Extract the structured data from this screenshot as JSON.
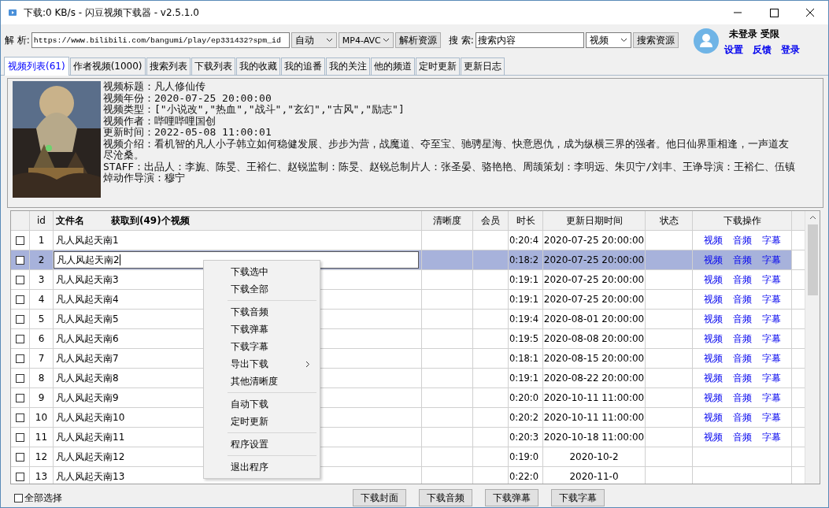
{
  "window": {
    "title": "下载:0 KB/s - 闪豆视频下载器 - v2.5.1.0"
  },
  "parse": {
    "label": "解 析:",
    "url": "https://www.bilibili.com/bangumi/play/ep331432?spm_id",
    "mode": "自动",
    "codec": "MP4-AVC",
    "button": "解析资源"
  },
  "search": {
    "label": "搜 索:",
    "value": "搜索内容",
    "type": "视频",
    "button": "搜索资源"
  },
  "account": {
    "status": "未登录 受限",
    "links": [
      "设置",
      "反馈",
      "登录"
    ]
  },
  "tabs": [
    {
      "label": "视频列表(61)",
      "selected": true
    },
    {
      "label": "作者视频(1000)",
      "selected": false
    },
    {
      "label": "搜索列表",
      "selected": false
    },
    {
      "label": "下载列表",
      "selected": false
    },
    {
      "label": "我的收藏",
      "selected": false
    },
    {
      "label": "我的追番",
      "selected": false
    },
    {
      "label": "我的关注",
      "selected": false
    },
    {
      "label": "他的频道",
      "selected": false
    },
    {
      "label": "定时更新",
      "selected": false
    },
    {
      "label": "更新日志",
      "selected": false
    }
  ],
  "info": {
    "lines": [
      "视频标题：凡人修仙传",
      "视频年份：2020-07-25 20:00:00",
      "视频类型：[\"小说改\",\"热血\",\"战斗\",\"玄幻\",\"古风\",\"励志\"]",
      "视频作者：哔哩哔哩国创",
      "更新时间：2022-05-08 11:00:01",
      "视频介绍：看机智的凡人小子韩立如何稳健发展、步步为营，战魔道、夺至宝、驰骋星海、快意恩仇，成为纵横三界的强者。他日仙界重相逢，一声道友尽沧桑。",
      "STAFF：出品人：李旎、陈旻、王裕仁、赵锐监制：陈旻、赵锐总制片人：张圣晏、骆艳艳、周颉策划：李明远、朱贝宁/刘丰、王诤导演：王裕仁、伍镇焯动作导演：穆宁"
    ]
  },
  "table": {
    "columns": [
      "id",
      "文件名",
      "获取到(49)个视频",
      "清晰度",
      "会员",
      "时长",
      "更新日期时间",
      "状态",
      "下载操作"
    ],
    "rows": [
      {
        "checked": false,
        "selected": false,
        "id": "1",
        "name": "凡人风起天南1",
        "duration": "0:20:4",
        "date": "2020-07-25 20:00:00",
        "actions": [
          "视频",
          "音频",
          "字幕"
        ]
      },
      {
        "checked": false,
        "selected": true,
        "id": "2",
        "name": "凡人风起天南2",
        "duration": "0:18:2",
        "date": "2020-07-25 20:00:00",
        "actions": [
          "视频",
          "音频",
          "字幕"
        ]
      },
      {
        "checked": false,
        "selected": false,
        "id": "3",
        "name": "凡人风起天南3",
        "duration": "0:19:1",
        "date": "2020-07-25 20:00:00",
        "actions": [
          "视频",
          "音频",
          "字幕"
        ]
      },
      {
        "checked": false,
        "selected": false,
        "id": "4",
        "name": "凡人风起天南4",
        "duration": "0:19:1",
        "date": "2020-07-25 20:00:00",
        "actions": [
          "视频",
          "音频",
          "字幕"
        ]
      },
      {
        "checked": false,
        "selected": false,
        "id": "5",
        "name": "凡人风起天南5",
        "duration": "0:19:4",
        "date": "2020-08-01 20:00:00",
        "actions": [
          "视频",
          "音频",
          "字幕"
        ]
      },
      {
        "checked": false,
        "selected": false,
        "id": "6",
        "name": "凡人风起天南6",
        "duration": "0:19:5",
        "date": "2020-08-08 20:00:00",
        "actions": [
          "视频",
          "音频",
          "字幕"
        ]
      },
      {
        "checked": false,
        "selected": false,
        "id": "7",
        "name": "凡人风起天南7",
        "duration": "0:18:1",
        "date": "2020-08-15 20:00:00",
        "actions": [
          "视频",
          "音频",
          "字幕"
        ]
      },
      {
        "checked": false,
        "selected": false,
        "id": "8",
        "name": "凡人风起天南8",
        "duration": "0:19:1",
        "date": "2020-08-22 20:00:00",
        "actions": [
          "视频",
          "音频",
          "字幕"
        ]
      },
      {
        "checked": false,
        "selected": false,
        "id": "9",
        "name": "凡人风起天南9",
        "duration": "0:20:0",
        "date": "2020-10-11 11:00:00",
        "actions": [
          "视频",
          "音频",
          "字幕"
        ]
      },
      {
        "checked": false,
        "selected": false,
        "id": "10",
        "name": "凡人风起天南10",
        "duration": "0:20:2",
        "date": "2020-10-11 11:00:00",
        "actions": [
          "视频",
          "音频",
          "字幕"
        ]
      },
      {
        "checked": false,
        "selected": false,
        "id": "11",
        "name": "凡人风起天南11",
        "duration": "0:20:3",
        "date": "2020-10-18 11:00:00",
        "actions": [
          "视频",
          "音频",
          "字幕"
        ]
      },
      {
        "checked": false,
        "selected": false,
        "id": "12",
        "name": "凡人风起天南12",
        "duration": "0:19:0",
        "date": "2020-10-2"
      },
      {
        "checked": false,
        "selected": false,
        "id": "13",
        "name": "凡人风起天南13",
        "duration": "0:22:0",
        "date": "2020-11-0"
      }
    ]
  },
  "context_menu": [
    {
      "kind": "item",
      "label": "下载选中",
      "submenu": false
    },
    {
      "kind": "item",
      "label": "下载全部",
      "submenu": false
    },
    {
      "kind": "separator"
    },
    {
      "kind": "item",
      "label": "下载音频",
      "submenu": false
    },
    {
      "kind": "item",
      "label": "下载弹幕",
      "submenu": false
    },
    {
      "kind": "item",
      "label": "下载字幕",
      "submenu": false
    },
    {
      "kind": "item",
      "label": "导出下载",
      "submenu": true
    },
    {
      "kind": "item",
      "label": "其他清晰度",
      "submenu": false
    },
    {
      "kind": "separator"
    },
    {
      "kind": "item",
      "label": "自动下载",
      "submenu": false
    },
    {
      "kind": "item",
      "label": "定时更新",
      "submenu": false
    },
    {
      "kind": "separator"
    },
    {
      "kind": "item",
      "label": "程序设置",
      "submenu": false
    },
    {
      "kind": "separator"
    },
    {
      "kind": "item",
      "label": "退出程序",
      "submenu": false
    }
  ],
  "footer": {
    "select_all": {
      "label": "全部选择",
      "checked": false
    },
    "buttons": [
      "下载封面",
      "下载音频",
      "下载弹幕",
      "下载字幕"
    ]
  }
}
